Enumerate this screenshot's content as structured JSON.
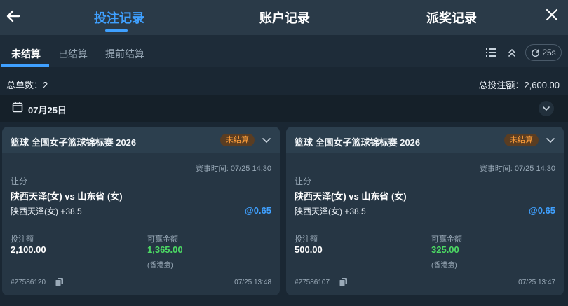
{
  "header": {
    "tabs": [
      {
        "label": "投注记录",
        "active": true
      },
      {
        "label": "账户记录",
        "active": false
      },
      {
        "label": "派奖记录",
        "active": false
      }
    ],
    "back_icon": "arrow-left-icon",
    "close_icon": "close-icon"
  },
  "subtabs": [
    {
      "label": "未结算",
      "active": true
    },
    {
      "label": "已结算",
      "active": false
    },
    {
      "label": "提前结算",
      "active": false
    }
  ],
  "toolbar": {
    "list_icon": "list-icon",
    "collapse_icon": "chevron-double-up-icon",
    "refresh_label": "25s"
  },
  "summary": {
    "count_text": "总单数：2",
    "total_text": "总投注额：2,600.00"
  },
  "date_group": {
    "label": "07月25日"
  },
  "bets": [
    {
      "title": "篮球 全国女子篮球锦标赛 2026",
      "status": "未结算",
      "match_time": "赛事时间: 07/25 14:30",
      "market": "让分",
      "teams": "陕西天泽(女) vs 山东省 (女)",
      "selection": "陕西天泽(女) +38.5",
      "odds": "@0.65",
      "stake_label": "投注额",
      "stake": "2,100.00",
      "payout_label": "可赢金额",
      "payout": "1,365.00",
      "payout_note": "(香港盘)",
      "bet_id": "#27586120",
      "bet_time": "07/25 13:48"
    },
    {
      "title": "篮球 全国女子篮球锦标赛 2026",
      "status": "未结算",
      "match_time": "赛事时间: 07/25 14:30",
      "market": "让分",
      "teams": "陕西天泽(女) vs 山东省 (女)",
      "selection": "陕西天泽(女) +38.5",
      "odds": "@0.65",
      "stake_label": "投注额",
      "stake": "500.00",
      "payout_label": "可赢金额",
      "payout": "325.00",
      "payout_note": "(香港盘)",
      "bet_id": "#27586107",
      "bet_time": "07/25 13:47"
    }
  ],
  "colors": {
    "accent": "#3fa0ff",
    "win": "#4cd964",
    "pending": "#ff9f3a"
  }
}
